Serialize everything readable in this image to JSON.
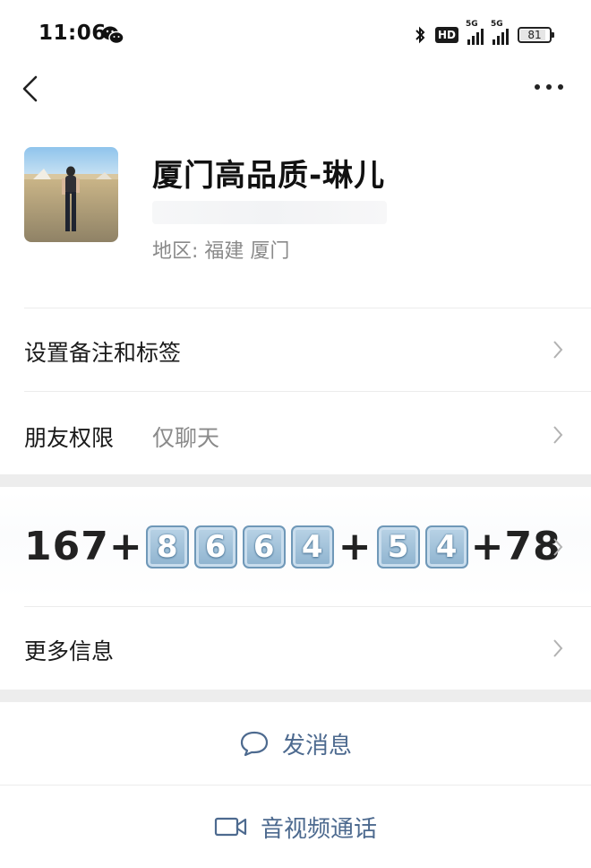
{
  "status_bar": {
    "time": "11:06",
    "wechat_icon": "wechat-icon",
    "hd_label": "HD",
    "signal1_label": "5G",
    "signal2_label": "5G",
    "battery": "81"
  },
  "nav": {
    "back_icon": "chevron-left-icon",
    "more_icon": "more-dots-icon"
  },
  "profile": {
    "name": "厦门高品质-琳儿",
    "region": "地区:  福建  厦门"
  },
  "rows": {
    "remark_label": "设置备注和标签",
    "permission_label": "朋友权限",
    "permission_value": "仅聊天",
    "more_info_label": "更多信息"
  },
  "signature": {
    "prefix": "167+",
    "keycaps_a": [
      "8",
      "6",
      "6",
      "4"
    ],
    "plus_mid": "+",
    "keycaps_b": [
      "5",
      "4"
    ],
    "suffix": "+78"
  },
  "actions": {
    "message_label": "发消息",
    "call_label": "音视频通话"
  },
  "colors": {
    "link": "#4d6a8f",
    "muted": "#8a8a8a",
    "separator": "#ededed"
  }
}
